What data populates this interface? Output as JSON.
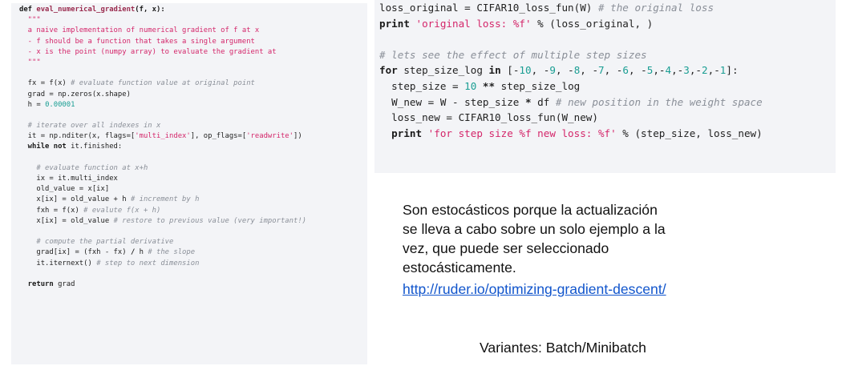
{
  "left_code": {
    "lines": [
      [
        {
          "t": "def ",
          "c": "kw"
        },
        {
          "t": "eval_numerical_gradient",
          "c": "fn"
        },
        {
          "t": "(f, x):",
          "c": "kw"
        }
      ],
      [
        {
          "t": "  \"\"\"",
          "c": "str"
        }
      ],
      [
        {
          "t": "  a naive implementation of numerical gradient of f at x",
          "c": "str"
        }
      ],
      [
        {
          "t": "  - f should be a function that takes a single argument",
          "c": "str"
        }
      ],
      [
        {
          "t": "  - x is the point (numpy array) to evaluate the gradient at",
          "c": "str"
        }
      ],
      [
        {
          "t": "  \"\"\"",
          "c": "str"
        }
      ],
      [],
      [
        {
          "t": "  fx = f(x) ",
          "c": ""
        },
        {
          "t": "# evaluate function value at original point",
          "c": "cmt"
        }
      ],
      [
        {
          "t": "  grad = np.zeros(x.shape)",
          "c": ""
        }
      ],
      [
        {
          "t": "  h = ",
          "c": ""
        },
        {
          "t": "0.00001",
          "c": "num"
        }
      ],
      [],
      [
        {
          "t": "  # iterate over all indexes in x",
          "c": "cmt"
        }
      ],
      [
        {
          "t": "  it = np.nditer(x, flags=[",
          "c": ""
        },
        {
          "t": "'multi_index'",
          "c": "str"
        },
        {
          "t": "], op_flags=[",
          "c": ""
        },
        {
          "t": "'readwrite'",
          "c": "str"
        },
        {
          "t": "])",
          "c": ""
        }
      ],
      [
        {
          "t": "  while not ",
          "c": "kw"
        },
        {
          "t": "it.finished:",
          "c": ""
        }
      ],
      [],
      [
        {
          "t": "    # evaluate function at x+h",
          "c": "cmt"
        }
      ],
      [
        {
          "t": "    ix = it.multi_index",
          "c": ""
        }
      ],
      [
        {
          "t": "    old_value = x[ix]",
          "c": ""
        }
      ],
      [
        {
          "t": "    x[ix] = old_value + h ",
          "c": ""
        },
        {
          "t": "# increment by h",
          "c": "cmt"
        }
      ],
      [
        {
          "t": "    fxh = f(x) ",
          "c": ""
        },
        {
          "t": "# evalute f(x + h)",
          "c": "cmt"
        }
      ],
      [
        {
          "t": "    x[ix] = old_value ",
          "c": ""
        },
        {
          "t": "# restore to previous value (very important!)",
          "c": "cmt"
        }
      ],
      [],
      [
        {
          "t": "    # compute the partial derivative",
          "c": "cmt"
        }
      ],
      [
        {
          "t": "    grad[ix] = (fxh - fx) ",
          "c": ""
        },
        {
          "t": "/",
          "c": "op"
        },
        {
          "t": " h ",
          "c": ""
        },
        {
          "t": "# the slope",
          "c": "cmt"
        }
      ],
      [
        {
          "t": "    it.iternext() ",
          "c": ""
        },
        {
          "t": "# step to next dimension",
          "c": "cmt"
        }
      ],
      [],
      [
        {
          "t": "  return ",
          "c": "kw"
        },
        {
          "t": "grad",
          "c": ""
        }
      ]
    ]
  },
  "right_code": {
    "lines": [
      [
        {
          "t": "loss_original = CIFAR10_loss_fun(W) ",
          "c": ""
        },
        {
          "t": "# the original loss",
          "c": "cmt"
        }
      ],
      [
        {
          "t": "print ",
          "c": "kw"
        },
        {
          "t": "'original loss: %f'",
          "c": "str"
        },
        {
          "t": " % (loss_original, )",
          "c": ""
        }
      ],
      [],
      [
        {
          "t": "# lets see the effect of multiple step sizes",
          "c": "cmt"
        }
      ],
      [
        {
          "t": "for ",
          "c": "kw"
        },
        {
          "t": "step_size_log ",
          "c": ""
        },
        {
          "t": "in ",
          "c": "kw"
        },
        {
          "t": "[-",
          "c": ""
        },
        {
          "t": "10",
          "c": "num"
        },
        {
          "t": ", -",
          "c": ""
        },
        {
          "t": "9",
          "c": "num"
        },
        {
          "t": ", -",
          "c": ""
        },
        {
          "t": "8",
          "c": "num"
        },
        {
          "t": ", -",
          "c": ""
        },
        {
          "t": "7",
          "c": "num"
        },
        {
          "t": ", -",
          "c": ""
        },
        {
          "t": "6",
          "c": "num"
        },
        {
          "t": ", -",
          "c": ""
        },
        {
          "t": "5",
          "c": "num"
        },
        {
          "t": ",-",
          "c": ""
        },
        {
          "t": "4",
          "c": "num"
        },
        {
          "t": ",-",
          "c": ""
        },
        {
          "t": "3",
          "c": "num"
        },
        {
          "t": ",-",
          "c": ""
        },
        {
          "t": "2",
          "c": "num"
        },
        {
          "t": ",-",
          "c": ""
        },
        {
          "t": "1",
          "c": "num"
        },
        {
          "t": "]:",
          "c": ""
        }
      ],
      [
        {
          "t": "  step_size = ",
          "c": ""
        },
        {
          "t": "10",
          "c": "num"
        },
        {
          "t": " ** ",
          "c": "op"
        },
        {
          "t": "step_size_log",
          "c": ""
        }
      ],
      [
        {
          "t": "  W_new = W - step_size ",
          "c": ""
        },
        {
          "t": "*",
          "c": "op"
        },
        {
          "t": " df ",
          "c": ""
        },
        {
          "t": "# new position in the weight space",
          "c": "cmt"
        }
      ],
      [
        {
          "t": "  loss_new = CIFAR10_loss_fun(W_new)",
          "c": ""
        }
      ],
      [
        {
          "t": "  print ",
          "c": "kw"
        },
        {
          "t": "'for step size %f new loss: %f'",
          "c": "str"
        },
        {
          "t": " % (step_size, loss_new)",
          "c": ""
        }
      ]
    ]
  },
  "text": {
    "paragraph": "Son estocásticos porque la actualización se lleva a cabo sobre un solo ejemplo a la vez, que puede ser seleccionado estocásticamente.",
    "link": "http://ruder.io/optimizing-gradient-descent/",
    "variants": "Variantes: Batch/Minibatch"
  }
}
